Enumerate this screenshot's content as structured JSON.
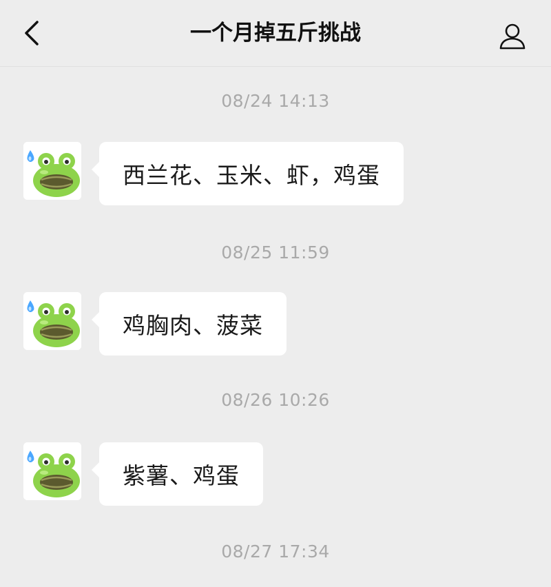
{
  "header": {
    "title": "一个月掉五斤挑战",
    "back_icon": "chevron-left-icon",
    "profile_icon": "person-icon"
  },
  "colors": {
    "background": "#ededed",
    "bubble": "#ffffff",
    "timestamp": "#a9a9a9",
    "frog_green": "#8ed34b"
  },
  "chat": {
    "groups": [
      {
        "time": "08/24 14:13",
        "message": "西兰花、玉米、虾，鸡蛋"
      },
      {
        "time": "08/25 11:59",
        "message": "鸡胸肉、菠菜"
      },
      {
        "time": "08/26 10:26",
        "message": "紫薯、鸡蛋"
      }
    ],
    "last_time": "08/27 17:34",
    "avatar": "frog-sweat-emoji-icon"
  }
}
